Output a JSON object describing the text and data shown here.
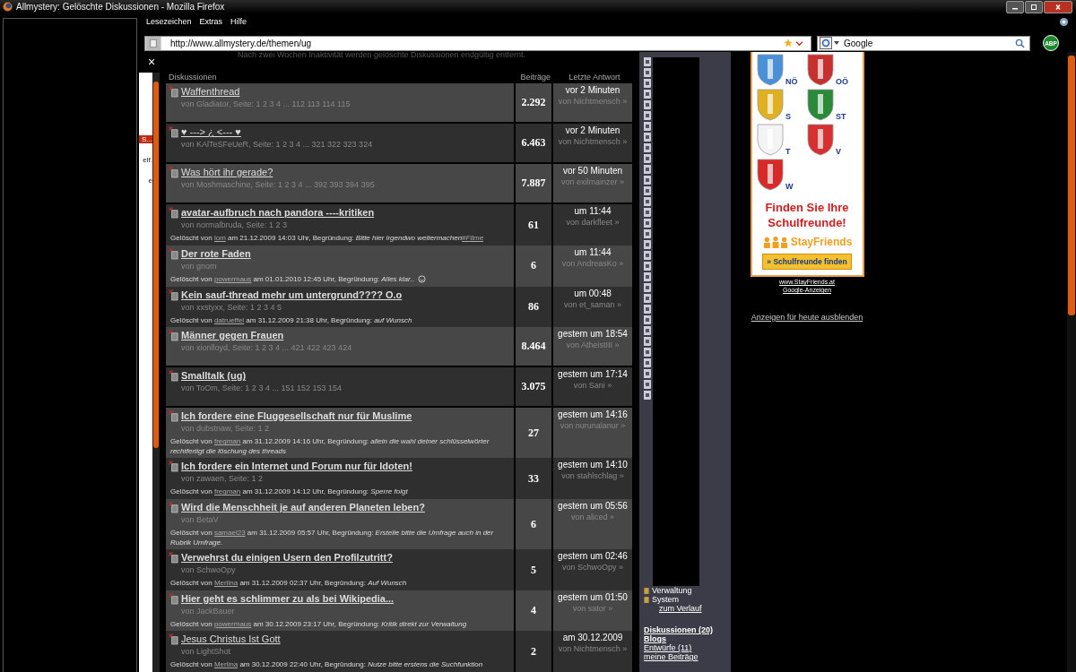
{
  "window": {
    "title": "Allmystery: Gelöschte Diskussionen - Mozilla Firefox"
  },
  "menu": [
    "Lesezeichen",
    "Extras",
    "Hilfe"
  ],
  "address_bar": {
    "value": "http://www.allmystery.de/themen/ug"
  },
  "search": {
    "value": "Google"
  },
  "addon_badge": "ABP",
  "sidebar_close": "×",
  "sidebar_fragments": [
    {
      "text": "S...",
      "selected": true
    },
    {
      "text": "elf.",
      "selected": false
    },
    {
      "text": "e",
      "selected": false
    }
  ],
  "notice": "Nach zwei Wochen Inaktivität werden gelöschte Diskussionen endgültig entfernt.",
  "columns": [
    "Diskussionen",
    "Beiträge",
    "Letzte Antwort"
  ],
  "rows": [
    {
      "title": "Waffenthread",
      "bold": false,
      "byline": "von Gladiator, Seite: 1 2 3 4 ... 112 113 114 115",
      "posts": "2.292",
      "last_time": "vor 2 Minuten",
      "last_by": "von Nichtmensch »"
    },
    {
      "title": "♥ ---> ¿ <--- ♥",
      "bold": false,
      "byline": "von KAlTeSFeUeR, Seite: 1 2 3 4 ... 321 322 323 324",
      "posts": "6.463",
      "last_time": "vor 2 Minuten",
      "last_by": "von Nichtmensch »"
    },
    {
      "title": "Was hört ihr gerade?",
      "bold": false,
      "byline": "von Moshmaschine, Seite: 1 2 3 4 ... 392 393 394 395",
      "posts": "7.887",
      "last_time": "vor 50 Minuten",
      "last_by": "von exilmainzer »"
    },
    {
      "title": "avatar-aufbruch nach pandora ----kritiken",
      "bold": true,
      "byline": "von normalbruda, Seite: 1 2 3",
      "deleted": {
        "prefix": "Gelöscht von",
        "by": "lom",
        "suffix": "am 21.12.2009 14:03 Uhr, Begründung:",
        "reason": "Bitte hier irgendwo weitermachen",
        "tag": "#Filme"
      },
      "posts": "61",
      "last_time": "um 11:44",
      "last_by": "von darkfleet »"
    },
    {
      "title": "Der rote Faden",
      "bold": true,
      "byline": "von gnom",
      "deleted": {
        "prefix": "Gelöscht von",
        "by": "powermaus",
        "suffix": "am 01.01.2010 12:45 Uhr, Begründung:",
        "reason": "Alles klar..",
        "smiley": true
      },
      "posts": "6",
      "last_time": "um 11:44",
      "last_by": "von AndreasKo »"
    },
    {
      "title": "Kein sauf-thread mehr um untergrund???? O.o",
      "bold": true,
      "byline": "von xxstyxx, Seite: 1 2 3 4 5",
      "deleted": {
        "prefix": "Gelöscht von",
        "by": "datrueffel",
        "suffix": "am 31.12.2009 21:38 Uhr, Begründung:",
        "reason": "auf Wunsch"
      },
      "posts": "86",
      "last_time": "um 00:48",
      "last_by": "von et_saman »"
    },
    {
      "title": "Männer gegen Frauen",
      "bold": true,
      "byline": "von xionlloyd, Seite: 1 2 3 4 ... 421 422 423 424",
      "posts": "8.464",
      "last_time": "gestern um 18:54",
      "last_by": "von AtheistIII »"
    },
    {
      "title": "Smalltalk (ug)",
      "bold": true,
      "byline": "von ToOm, Seite: 1 2 3 4 ... 151 152 153 154",
      "posts": "3.075",
      "last_time": "gestern um 17:14",
      "last_by": "von Sani »"
    },
    {
      "title": "Ich fordere eine Fluggesellschaft nur für Muslime",
      "bold": true,
      "byline": "von dubstnaw, Seite: 1 2",
      "deleted": {
        "prefix": "Gelöscht von",
        "by": "fregman",
        "suffix": "am 31.12.2009 14:16 Uhr, Begründung:",
        "reason": "allein die wahl deiner schlüsselwörter rechtfertigt die löschung des threads"
      },
      "posts": "27",
      "last_time": "gestern um 14:16",
      "last_by": "von nurunalanur »"
    },
    {
      "title": "Ich fordere ein Internet und Forum nur für Idoten!",
      "bold": true,
      "byline": "von zawaen, Seite: 1 2",
      "deleted": {
        "prefix": "Gelöscht von",
        "by": "fregman",
        "suffix": "am 31.12.2009 14:12 Uhr, Begründung:",
        "reason": "Sperre folgt"
      },
      "posts": "33",
      "last_time": "gestern um 14:10",
      "last_by": "von stahlschlag »"
    },
    {
      "title": "Wird die Menschheit je auf anderen Planeten leben?",
      "bold": true,
      "byline": "von BetaV",
      "deleted": {
        "prefix": "Gelöscht von",
        "by": "samael23",
        "suffix": "am 31.12.2009 05:57 Uhr, Begründung:",
        "reason": "Erstelle bitte die Umfrage auch in der Rubrik Umfrage."
      },
      "posts": "6",
      "last_time": "gestern um 05:56",
      "last_by": "von aliced »"
    },
    {
      "title": "Verwehrst du einigen Usern den Profilzutritt?",
      "bold": true,
      "byline": "von SchwoOpy",
      "deleted": {
        "prefix": "Gelöscht von",
        "by": "Merlina",
        "suffix": "am 31.12.2009 02:37 Uhr, Begründung:",
        "reason": "Auf Wunsch"
      },
      "posts": "5",
      "last_time": "gestern um 02:46",
      "last_by": "von SchwoOpy »"
    },
    {
      "title": "Hier geht es schlimmer zu als bei Wikipedia...",
      "bold": true,
      "byline": "von JackBauer",
      "deleted": {
        "prefix": "Gelöscht von",
        "by": "powermaus",
        "suffix": "am 30.12.2009 23:17 Uhr, Begründung:",
        "reason": "Kritik direkt zur Verwaltung"
      },
      "posts": "4",
      "last_time": "gestern um 01:50",
      "last_by": "von sator »"
    },
    {
      "title": "Jesus Christus Ist Gott",
      "bold": false,
      "byline": "von LightShot",
      "deleted": {
        "prefix": "Gelöscht von",
        "by": "Merlina",
        "suffix": "am 30.12.2009 22:40 Uhr, Begründung:",
        "reason": "Nutze bitte erstens die Suchfunktion"
      },
      "posts": "2",
      "last_time": "am 30.12.2009",
      "last_by": "von Nichtmensch »"
    }
  ],
  "nav": {
    "items": [
      "Verwaltung",
      "System"
    ],
    "history_link": "zum Verlauf",
    "links": [
      {
        "label": "Diskussionen (20)",
        "bold": true
      },
      {
        "label": "Blogs",
        "bold": true
      },
      {
        "label": "Entwürfe (11)",
        "bold": false
      },
      {
        "label": "meine Beiträge",
        "bold": false
      }
    ]
  },
  "ad": {
    "regions": [
      {
        "code": "NÖ",
        "color": "#4a90d8"
      },
      {
        "code": "OÖ",
        "color": "#c83030"
      },
      {
        "code": "S",
        "color": "#e0b020"
      },
      {
        "code": "ST",
        "color": "#2a8a3a"
      },
      {
        "code": "T",
        "color": "#f4f4f4"
      },
      {
        "code": "V",
        "color": "#d83030"
      },
      {
        "code": "W",
        "color": "#d82828"
      }
    ],
    "headline": "Finden Sie Ihre Schulfreunde!",
    "brand": "StayFriends",
    "button": "» Schulfreunde finden",
    "url": "www.StayFriends.at",
    "source": "Google-Anzeigen"
  },
  "hide_ads": "Anzeigen für heute ausblenden"
}
